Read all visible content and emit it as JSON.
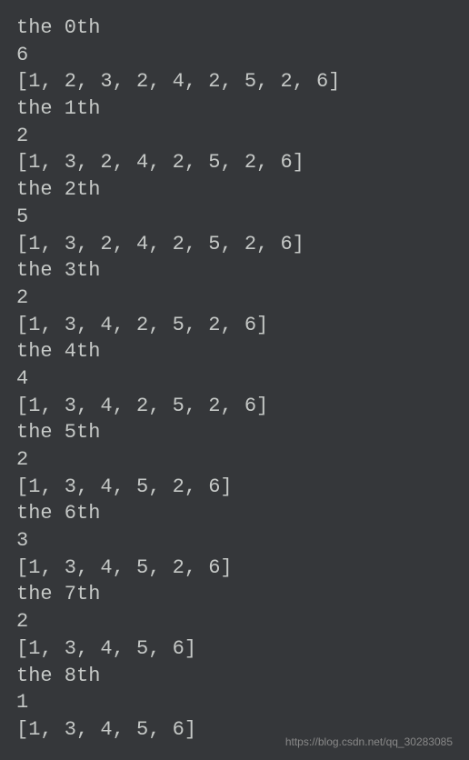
{
  "console": {
    "lines": [
      "the 0th",
      "6",
      "[1, 2, 3, 2, 4, 2, 5, 2, 6]",
      "the 1th",
      "2",
      "[1, 3, 2, 4, 2, 5, 2, 6]",
      "the 2th",
      "5",
      "[1, 3, 2, 4, 2, 5, 2, 6]",
      "the 3th",
      "2",
      "[1, 3, 4, 2, 5, 2, 6]",
      "the 4th",
      "4",
      "[1, 3, 4, 2, 5, 2, 6]",
      "the 5th",
      "2",
      "[1, 3, 4, 5, 2, 6]",
      "the 6th",
      "3",
      "[1, 3, 4, 5, 2, 6]",
      "the 7th",
      "2",
      "[1, 3, 4, 5, 6]",
      "the 8th",
      "1",
      "[1, 3, 4, 5, 6]"
    ]
  },
  "watermark": "https://blog.csdn.net/qq_30283085"
}
